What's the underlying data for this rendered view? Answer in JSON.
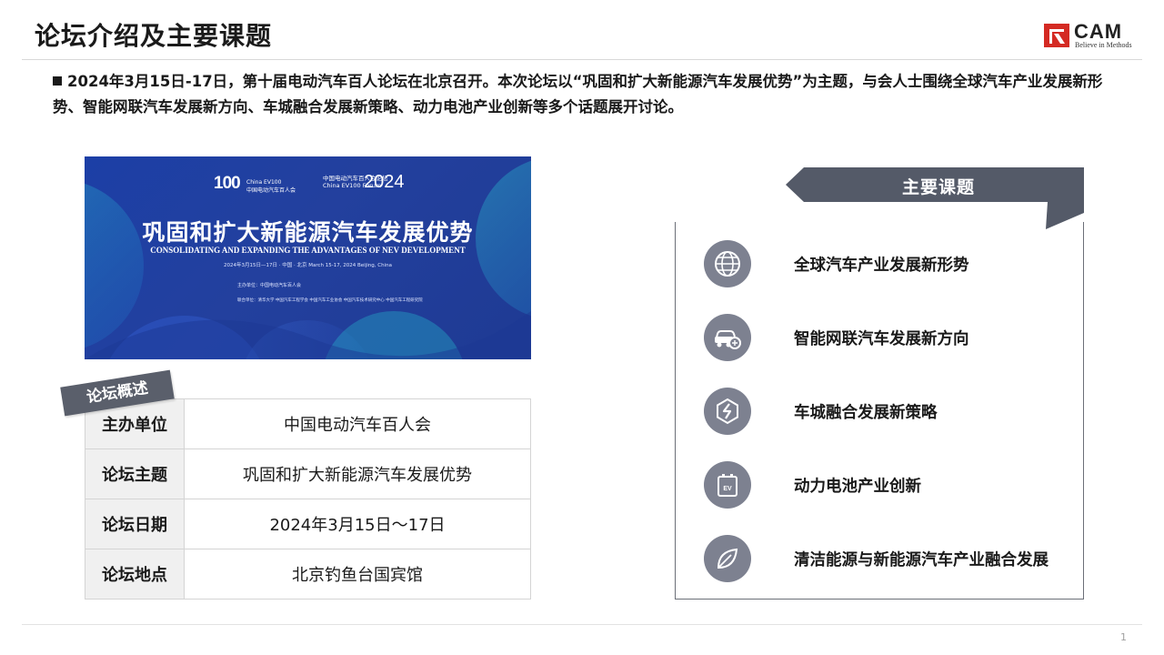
{
  "header": {
    "title": "论坛介绍及主要课题",
    "logo_text": "CAM",
    "logo_slogan": "Believe in Methods",
    "logo_color": "#d42a23"
  },
  "intro": {
    "text": "2024年3月15日-17日，第十届电动汽车百人论坛在北京召开。本次论坛以“巩固和扩大新能源汽车发展优势”为主题，与会人士围绕全球汽车产业发展新形势、智能网联汽车发展新方向、车城融合发展新策略、动力电池产业创新等多个话题展开讨论。"
  },
  "banner": {
    "logo": "100",
    "brand_line1": "China EV100",
    "brand_line2": "中国电动汽车百人会",
    "forum_cn": "中国电动汽车百人会论坛",
    "forum_en": "China EV100 Forum",
    "year": "2024",
    "title": "巩固和扩大新能源汽车发展优势",
    "subtitle": "CONSOLIDATING AND EXPANDING THE ADVANTAGES OF NEV DEVELOPMENT",
    "date_line": "2024年3月15日—17日 · 中国 · 北京          March 15-17, 2024  Beijing, China",
    "host_line": "主办单位：中国电动汽车百人会",
    "co_line": "联合单位：清华大学    中国汽车工程学会    中国汽车工业协会    中国汽车技术研究中心    中国汽车工程研究院"
  },
  "overview": {
    "tag": "论坛概述",
    "rows": [
      {
        "key": "主办单位",
        "value": "中国电动汽车百人会"
      },
      {
        "key": "论坛主题",
        "value": "巩固和扩大新能源汽车发展优势"
      },
      {
        "key": "论坛日期",
        "value": "2024年3月15日～17日"
      },
      {
        "key": "论坛地点",
        "value": "北京钓鱼台国宾馆"
      }
    ]
  },
  "topics": {
    "heading": "主要课题",
    "heading_color": "#545a68",
    "icon_color": "#7d8190",
    "items": [
      {
        "label": "全球汽车产业发展新形势",
        "icon": "globe-icon"
      },
      {
        "label": "智能网联汽车发展新方向",
        "icon": "connected-car-icon"
      },
      {
        "label": "车城融合发展新策略",
        "icon": "hexagon-bolt-icon"
      },
      {
        "label": "动力电池产业创新",
        "icon": "ev-battery-icon"
      },
      {
        "label": "清洁能源与新能源汽车产业融合发展",
        "icon": "leaf-icon"
      }
    ]
  },
  "footer": {
    "page_number": "1"
  }
}
